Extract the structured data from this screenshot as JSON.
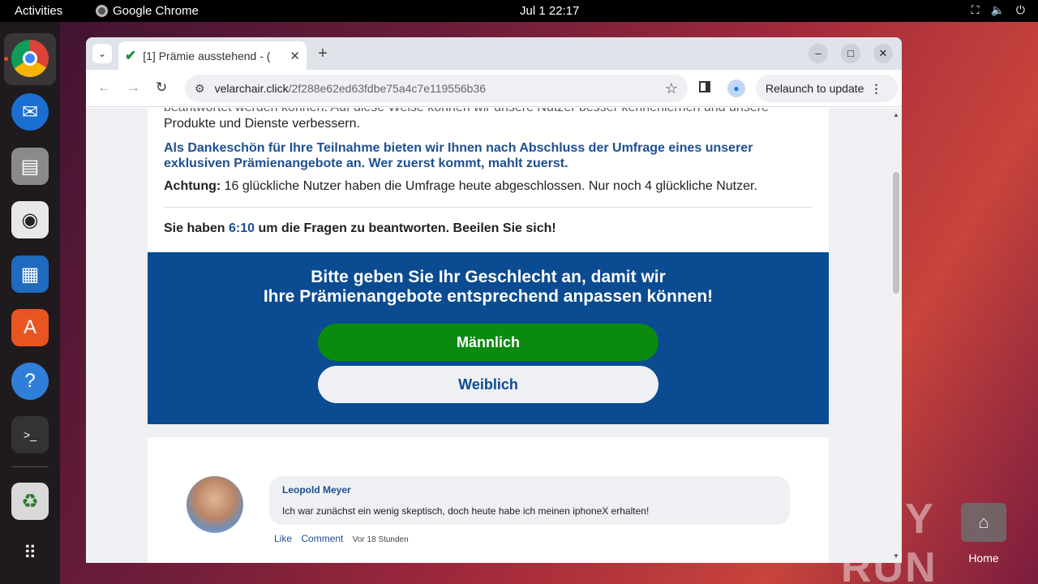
{
  "topbar": {
    "activities": "Activities",
    "app_name": "Google Chrome",
    "clock": "Jul 1  22:17"
  },
  "tab": {
    "title": "[1] Prämie ausstehend - ("
  },
  "address": {
    "domain": "velarchair.click",
    "path": "/2f288e62ed63fdbe75a4c7e119556b36"
  },
  "toolbar": {
    "relaunch_label": "Relaunch to update"
  },
  "page": {
    "intro_cut": "beantwortet werden können. Auf diese Weise können wir unsere Nutzer besser kennenlernen und unsere",
    "intro_end": "Produkte und Dienste verbessern.",
    "thanks": "Als Dankeschön für Ihre Teilnahme bieten wir Ihnen nach Abschluss der Umfrage eines unserer exklusiven Prämienangebote an. Wer zuerst kommt, mahlt zuerst.",
    "attention_label": "Achtung:",
    "attention_text": " 16 glückliche Nutzer haben die Umfrage heute abgeschlossen. Nur noch 4 glückliche Nutzer.",
    "timer_prefix": "Sie haben ",
    "timer_value": "6:10",
    "timer_suffix": " um die Fragen zu beantworten. Beeilen Sie sich!",
    "gender_heading_1": "Bitte geben Sie Ihr Geschlecht an, damit wir",
    "gender_heading_2": "Ihre Prämienangebote entsprechend anpassen können!",
    "male_button": "Männlich",
    "female_button": "Weiblich"
  },
  "comment": {
    "author": "Leopold Meyer",
    "text": "Ich war zunächst ein wenig skeptisch, doch heute habe ich meinen iphoneX erhalten!",
    "like": "Like",
    "reply": "Comment",
    "time": "Vor 18 Stunden"
  },
  "desktop": {
    "home_label": "Home",
    "watermark": "ANY RUN"
  }
}
